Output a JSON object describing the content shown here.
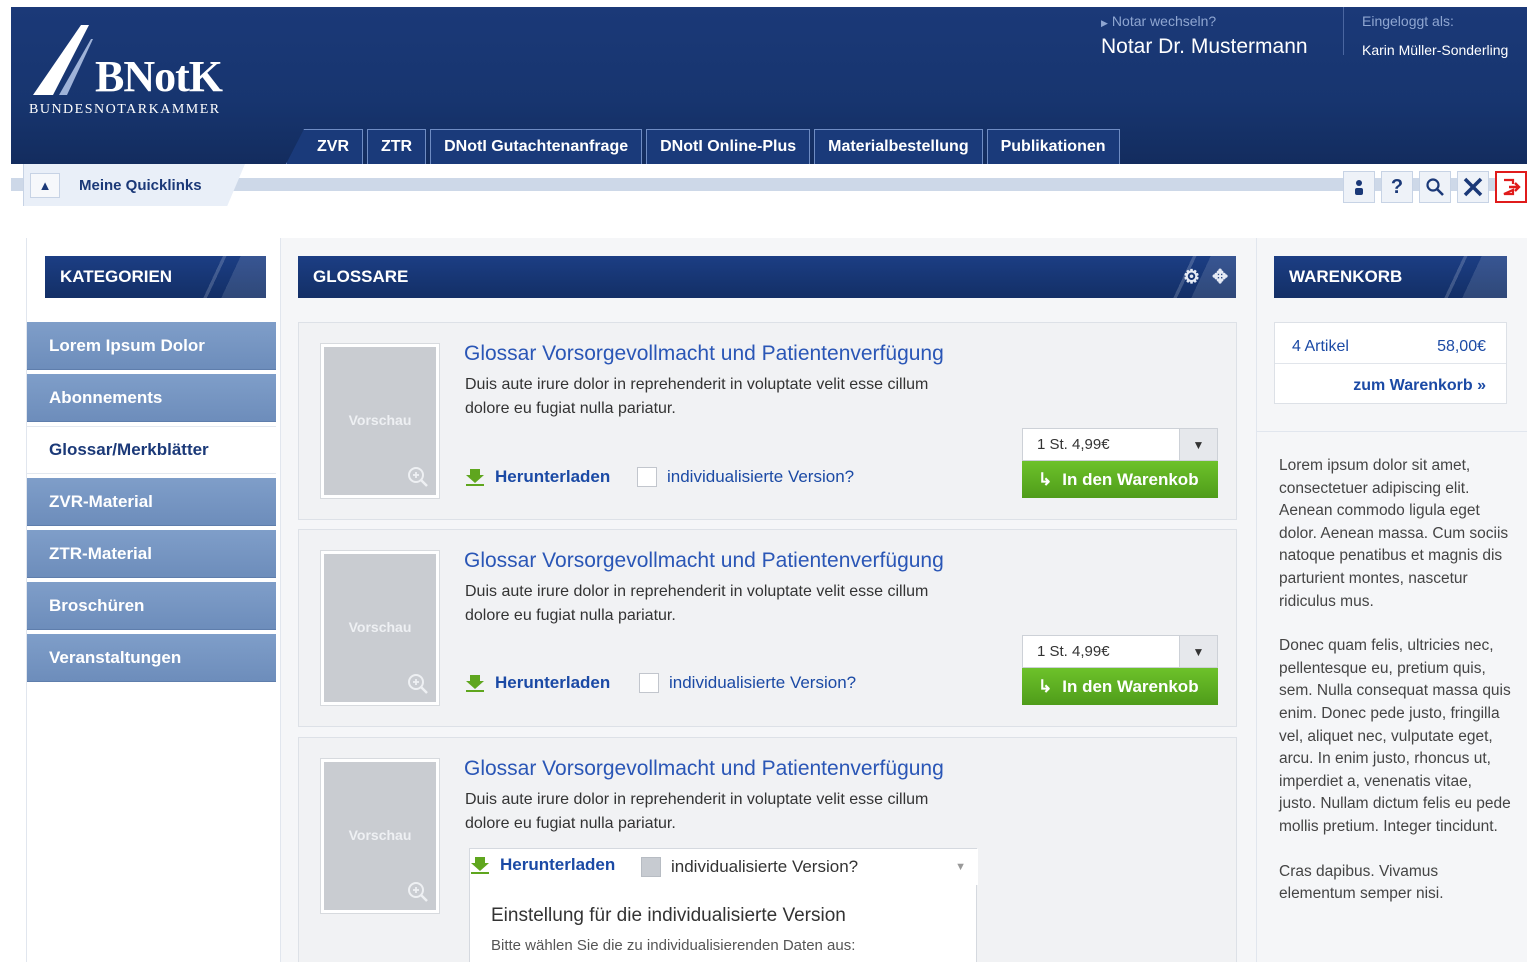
{
  "header": {
    "logo_name": "BNotK",
    "logo_sub": "BUNDESNOTARKAMMER",
    "notar_switch": "Notar wechseln?",
    "notar_name": "Notar Dr. Mustermann",
    "login_label": "Eingeloggt als:",
    "login_name": "Karin Müller-Sonderling"
  },
  "nav": {
    "tabs": [
      {
        "label": "ZVR"
      },
      {
        "label": "ZTR"
      },
      {
        "label": "DNotI Gutachtenanfrage"
      },
      {
        "label": "DNotI Online-Plus"
      },
      {
        "label": "Materialbestellung"
      },
      {
        "label": "Publikationen"
      }
    ]
  },
  "quicklinks": {
    "label": "Meine Quicklinks"
  },
  "tools": {
    "icons": [
      "user-icon",
      "help-icon",
      "search-icon",
      "settings-icon",
      "logout-icon"
    ]
  },
  "categories": {
    "title": "KATEGORIEN",
    "items": [
      {
        "label": "Lorem Ipsum Dolor"
      },
      {
        "label": "Abonnements"
      },
      {
        "label": "Glossar/Merkblätter",
        "active": true
      },
      {
        "label": "ZVR-Material"
      },
      {
        "label": "ZTR-Material"
      },
      {
        "label": "Broschüren"
      },
      {
        "label": "Veranstaltungen"
      }
    ]
  },
  "glossare": {
    "title": "GLOSSARE",
    "products": [
      {
        "thumb_label": "Vorschau",
        "title": "Glossar Vorsorgevollmacht und Patientenverfügung",
        "desc": "Duis aute irure dolor in reprehenderit in voluptate velit esse cillum dolore eu fugiat nulla pariatur.",
        "download": "Herunterladen",
        "checkbox": "individualisierte Version?",
        "qty": "1 St. 4,99€",
        "cart_button": "In den Warenkob"
      },
      {
        "thumb_label": "Vorschau",
        "title": "Glossar Vorsorgevollmacht und Patientenverfügung",
        "desc": "Duis aute irure dolor in reprehenderit in voluptate velit esse cillum dolore eu fugiat nulla pariatur.",
        "download": "Herunterladen",
        "checkbox": "individualisierte Version?",
        "qty": "1 St. 4,99€",
        "cart_button": "In den Warenkob"
      },
      {
        "thumb_label": "Vorschau",
        "title": "Glossar Vorsorgevollmacht und Patientenverfügung",
        "desc": "Duis aute irure dolor in reprehenderit in voluptate velit esse cillum dolore eu fugiat nulla pariatur.",
        "download": "Herunterladen",
        "checkbox": "individualisierte Version?",
        "custom_heading": "Einstellung für die individualisierte Version",
        "custom_sub": "Bitte wählen Sie die zu individualisierenden Daten aus:"
      }
    ]
  },
  "warenkorb": {
    "title": "WARENKORB",
    "count": "4 Artikel",
    "sum": "58,00€",
    "link": "zum Warenkorb »",
    "text_1": "Lorem ipsum dolor sit amet, consectetuer adipiscing elit. Aenean commodo ligula eget dolor. Aenean massa. Cum sociis natoque penatibus et magnis dis parturient montes, nascetur ridiculus mus.",
    "text_2": "Donec quam felis, ultricies nec, pellentesque eu, pretium quis, sem. Nulla consequat massa quis enim. Donec pede justo, fringilla vel, aliquet nec, vulputate eget, arcu. In enim justo, rhoncus ut, imperdiet a, venenatis vitae, justo. Nullam dictum felis eu pede mollis pretium. Integer tincidunt.",
    "text_3": "Cras dapibus. Vivamus elementum semper nisi."
  }
}
